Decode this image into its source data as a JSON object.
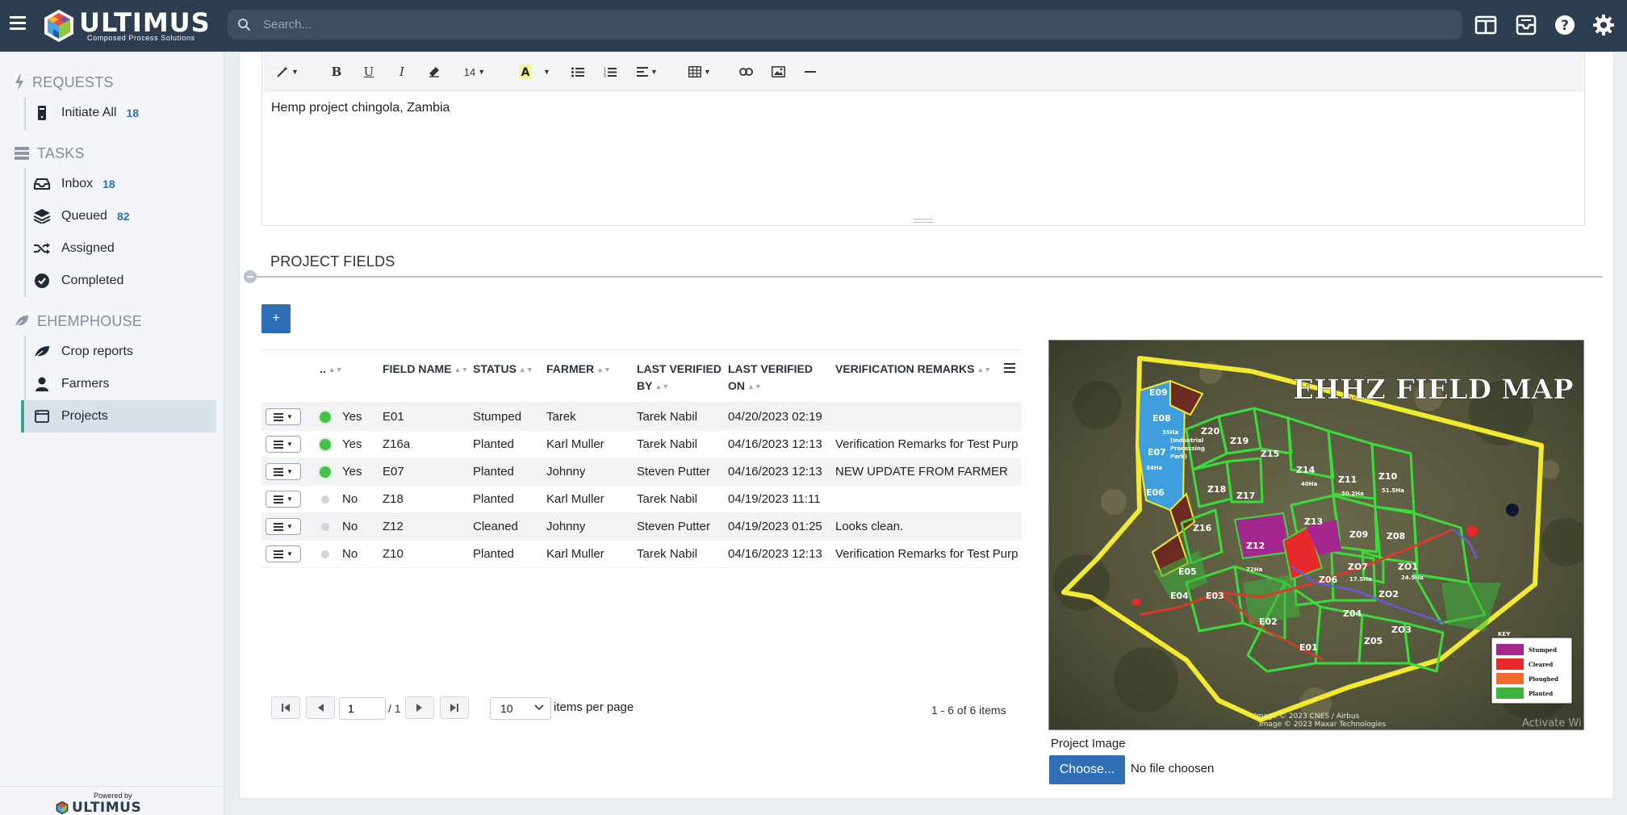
{
  "header": {
    "logo_word": "ULTIMUS",
    "logo_tagline": "Composed Process Solutions",
    "search_placeholder": "Search..."
  },
  "sidebar": {
    "sections": [
      {
        "title": "REQUESTS",
        "icon": "bolt-icon",
        "items": [
          {
            "label": "Initiate All",
            "count": "18",
            "icon": "phone-icon"
          }
        ]
      },
      {
        "title": "TASKS",
        "icon": "stack-icon",
        "items": [
          {
            "label": "Inbox",
            "count": "18",
            "icon": "inbox-icon"
          },
          {
            "label": "Queued",
            "count": "82",
            "icon": "layers-icon"
          },
          {
            "label": "Assigned",
            "count": "",
            "icon": "shuffle-icon"
          },
          {
            "label": "Completed",
            "count": "",
            "icon": "check-circle-icon"
          }
        ]
      },
      {
        "title": "EHEMPHOUSE",
        "icon": "leaf-icon",
        "items": [
          {
            "label": "Crop reports",
            "icon": "leaf-icon"
          },
          {
            "label": "Farmers",
            "icon": "user-icon"
          },
          {
            "label": "Projects",
            "icon": "window-icon",
            "active": true
          }
        ]
      }
    ],
    "powered_small": "Powered by",
    "powered_logo": "ULTIMUS"
  },
  "editor": {
    "font_size": "14",
    "content": "Hemp project chingola, Zambia"
  },
  "project_fields": {
    "title": "PROJECT FIELDS",
    "add_label": "+",
    "columns": {
      "active": "..",
      "field_name": "FIELD NAME",
      "status": "STATUS",
      "farmer": "FARMER",
      "last_verified_by": "LAST VERIFIED BY",
      "last_verified_on": "LAST VERIFIED ON",
      "verification_remarks": "VERIFICATION REMARKS"
    },
    "rows": [
      {
        "active": "Yes",
        "on": true,
        "field_name": "E01",
        "status": "Stumped",
        "farmer": "Tarek",
        "verified_by": "Tarek Nabil",
        "verified_on": "04/20/2023 02:19",
        "remarks": ""
      },
      {
        "active": "Yes",
        "on": true,
        "field_name": "Z16a",
        "status": "Planted",
        "farmer": "Karl Muller",
        "verified_by": "Tarek Nabil",
        "verified_on": "04/16/2023 12:13",
        "remarks": "Verification Remarks for Test Purp"
      },
      {
        "active": "Yes",
        "on": true,
        "field_name": "E07",
        "status": "Planted",
        "farmer": "Johnny",
        "verified_by": "Steven Putter",
        "verified_on": "04/16/2023 12:13",
        "remarks": "NEW UPDATE FROM FARMER"
      },
      {
        "active": "No",
        "on": false,
        "field_name": "Z18",
        "status": "Planted",
        "farmer": "Karl Muller",
        "verified_by": "Tarek Nabil",
        "verified_on": "04/19/2023 11:11",
        "remarks": ""
      },
      {
        "active": "No",
        "on": false,
        "field_name": "Z12",
        "status": "Cleaned",
        "farmer": "Johnny",
        "verified_by": "Steven Putter",
        "verified_on": "04/19/2023 01:25",
        "remarks": "Looks clean."
      },
      {
        "active": "No",
        "on": false,
        "field_name": "Z10",
        "status": "Planted",
        "farmer": "Karl Muller",
        "verified_by": "Tarek Nabil",
        "verified_on": "04/16/2023 12:13",
        "remarks": "Verification Remarks for Test Purp"
      }
    ],
    "pager": {
      "page": "1",
      "total": "/ 1",
      "page_size": "10",
      "items_per_page": "items per page",
      "info": "1 - 6 of 6 items"
    }
  },
  "image": {
    "map_title": "EHHZ FIELD MAP",
    "key_title": "KEY",
    "key": [
      {
        "label": "Stumped",
        "color": "#a4278f"
      },
      {
        "label": "Cleared",
        "color": "#e8282a"
      },
      {
        "label": "Ploughed",
        "color": "#f06a2a"
      },
      {
        "label": "Planted",
        "color": "#3cb43c"
      }
    ],
    "credit_1": "Image © 2023 CNES / Airbus",
    "credit_2": "Image © 2023 Maxar Technologies",
    "watermark": "Activate Wi",
    "label": "Project Image",
    "choose_label": "Choose...",
    "file_text": "No file choosen"
  },
  "colors": {
    "topbar": "#2d3e50",
    "accent_blue": "#2f6db5",
    "active_green": "#44c24a",
    "active_marker": "#3aa68f"
  }
}
